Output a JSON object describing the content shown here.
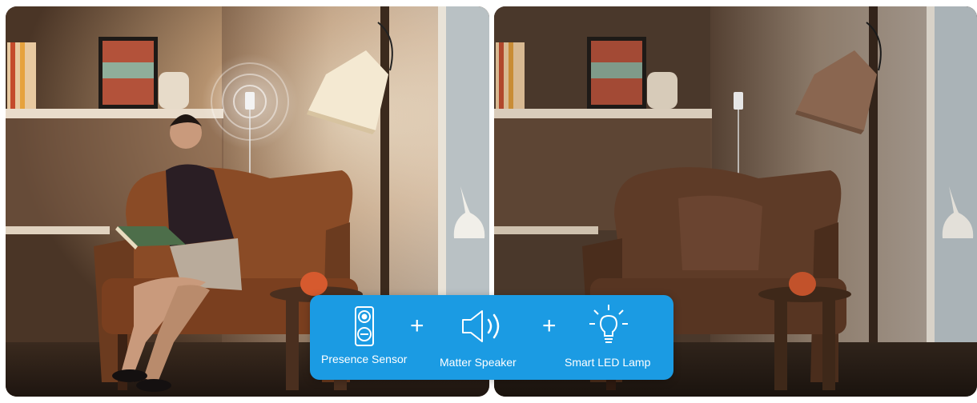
{
  "scene": {
    "left_panel": "lit-room-with-person-reading",
    "right_panel": "dim-room-empty-chair"
  },
  "info_bar": {
    "background": "#1b9be3",
    "items": [
      {
        "label": "Presence Sensor",
        "icon": "presence-sensor-icon"
      },
      {
        "label": "Matter Speaker",
        "icon": "speaker-icon"
      },
      {
        "label": "Smart LED Lamp",
        "icon": "light-bulb-icon"
      }
    ],
    "separator": "+"
  }
}
